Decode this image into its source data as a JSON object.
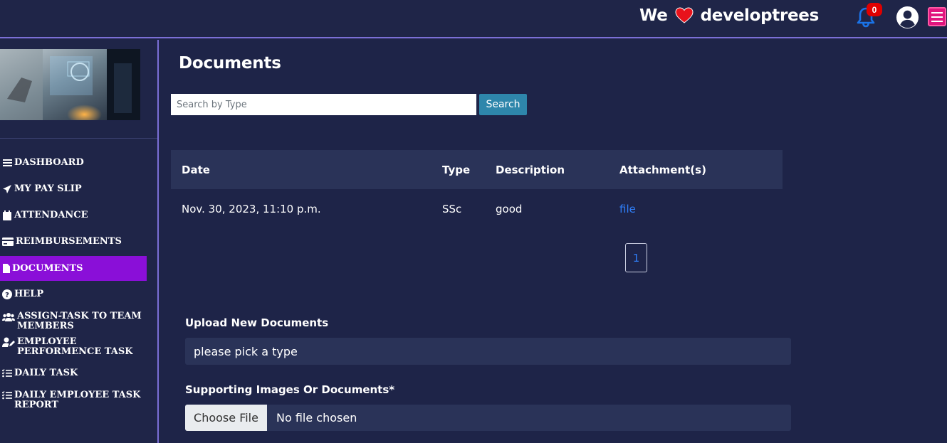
{
  "header": {
    "brand_prefix": "We",
    "brand_name": "developtrees",
    "notification_count": "0",
    "icons": {
      "bell": "bell-icon",
      "user": "user-circle-icon",
      "menu": "hamburger-icon",
      "heart": "heart-icon"
    },
    "colors": {
      "background": "#1f2548",
      "accent_border": "#7b6fd6",
      "menu_button": "#e1157e",
      "badge": "#e00000",
      "bell": "#1a73e8"
    }
  },
  "sidebar": {
    "items": [
      {
        "label": "DASHBOARD",
        "icon": "bars-icon"
      },
      {
        "label": "MY PAY SLIP",
        "icon": "paper-plane-icon"
      },
      {
        "label": "ATTENDANCE",
        "icon": "calendar-icon"
      },
      {
        "label": "REIMBURSEMENTS",
        "icon": "credit-card-icon"
      },
      {
        "label": "DOCUMENTS",
        "icon": "file-icon",
        "active": true
      },
      {
        "label": "HELP",
        "icon": "question-circle-icon"
      },
      {
        "label": "ASSIGN-TASK TO TEAM MEMBERS",
        "icon": "users-icon"
      },
      {
        "label": "EMPLOYEE PERFORMENCE TASK",
        "icon": "user-edit-icon"
      },
      {
        "label": "DAILY TASK",
        "icon": "tasks-icon"
      },
      {
        "label": "DAILY EMPLOYEE TASK REPORT",
        "icon": "tasks-icon"
      }
    ],
    "active_color": "#8a0fd8"
  },
  "main": {
    "title": "Documents",
    "search": {
      "placeholder": "Search by Type",
      "value": "",
      "button_label": "Search"
    },
    "table": {
      "headers": [
        "Date",
        "Type",
        "Description",
        "Attachment(s)"
      ],
      "rows": [
        {
          "date": "Nov. 30, 2023, 11:10 p.m.",
          "type": "SSc",
          "description": "good",
          "attachment": "file"
        }
      ]
    },
    "pagination": {
      "current_page": "1"
    },
    "upload": {
      "section_label": "Upload New Documents",
      "type_select_value": "please pick a type",
      "supporting_label": "Supporting Images Or Documents*",
      "choose_file_label": "Choose File",
      "file_status": "No file chosen"
    }
  }
}
